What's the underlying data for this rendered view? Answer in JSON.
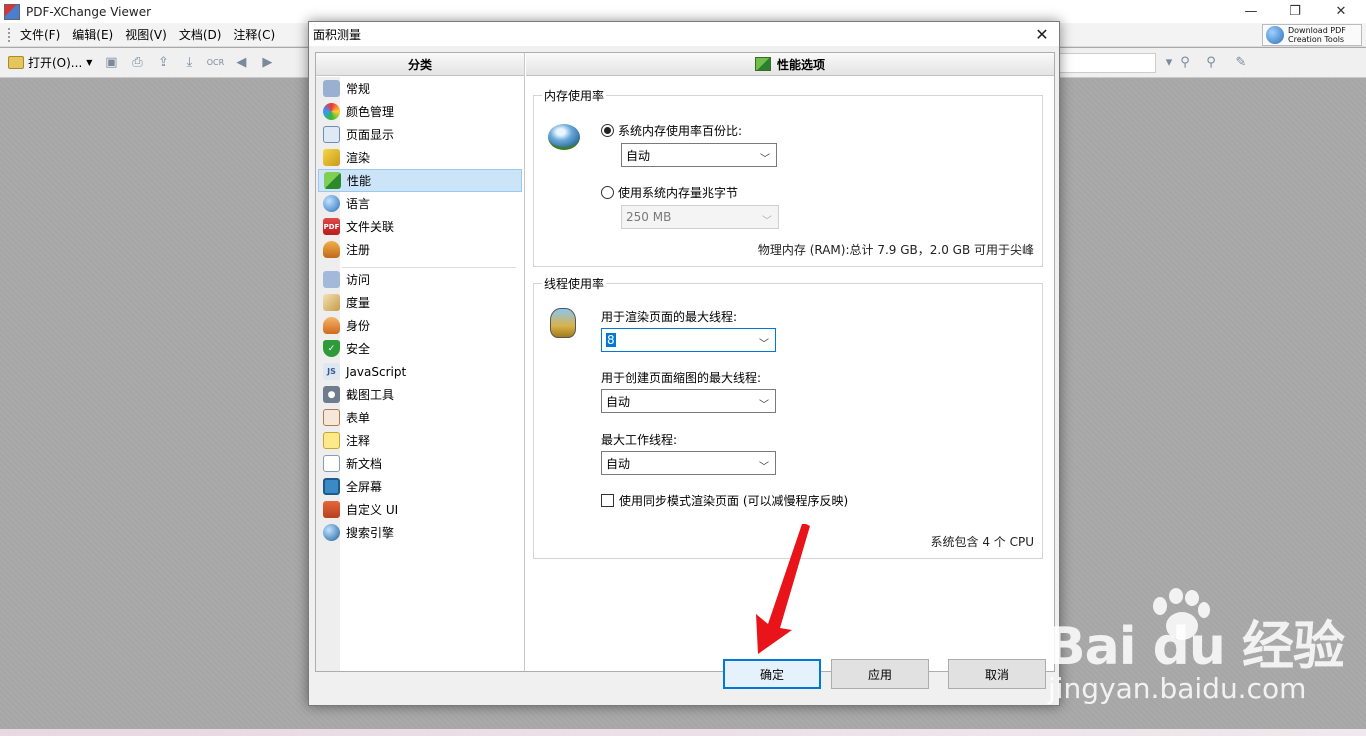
{
  "app": {
    "title": "PDF-XChange Viewer",
    "menu": [
      "文件(F)",
      "编辑(E)",
      "视图(V)",
      "文档(D)",
      "注释(C)"
    ],
    "toolbar_open": "打开(O)...",
    "download_line1": "Download PDF",
    "download_line2": "Creation Tools"
  },
  "dialog": {
    "title": "面积测量",
    "left_header": "分类",
    "right_header": "性能选项",
    "categories_group1": [
      "常规",
      "颜色管理",
      "页面显示",
      "渲染",
      "性能",
      "语言",
      "文件关联",
      "注册"
    ],
    "categories_group2": [
      "访问",
      "度量",
      "身份",
      "安全",
      "JavaScript",
      "截图工具",
      "表单",
      "注释",
      "新文档",
      "全屏幕",
      "自定义 UI",
      "搜索引擎"
    ],
    "selected_category": "性能",
    "memory": {
      "group_title": "内存使用率",
      "radio1_label": "系统内存使用率百份比:",
      "radio1_value": "自动",
      "radio2_label": "使用系统内存量兆字节",
      "radio2_value": "250 MB",
      "info": "物理内存 (RAM):总计 7.9 GB，2.0 GB 可用于尖峰"
    },
    "threads": {
      "group_title": "线程使用率",
      "render_label": "用于渲染页面的最大线程:",
      "render_value": "8",
      "thumb_label": "用于创建页面缩图的最大线程:",
      "thumb_value": "自动",
      "worker_label": "最大工作线程:",
      "worker_value": "自动",
      "sync_label": "使用同步模式渲染页面 (可以减慢程序反映)",
      "cpu_info": "系统包含 4 个 CPU"
    },
    "buttons": {
      "ok": "确定",
      "apply": "应用",
      "cancel": "取消"
    }
  },
  "watermark": {
    "logo": "Bai du 经验",
    "url": "jingyan.baidu.com"
  },
  "colors": {
    "selection": "#cce4f7",
    "accent": "#0078d7",
    "arrow": "#e8141a"
  }
}
